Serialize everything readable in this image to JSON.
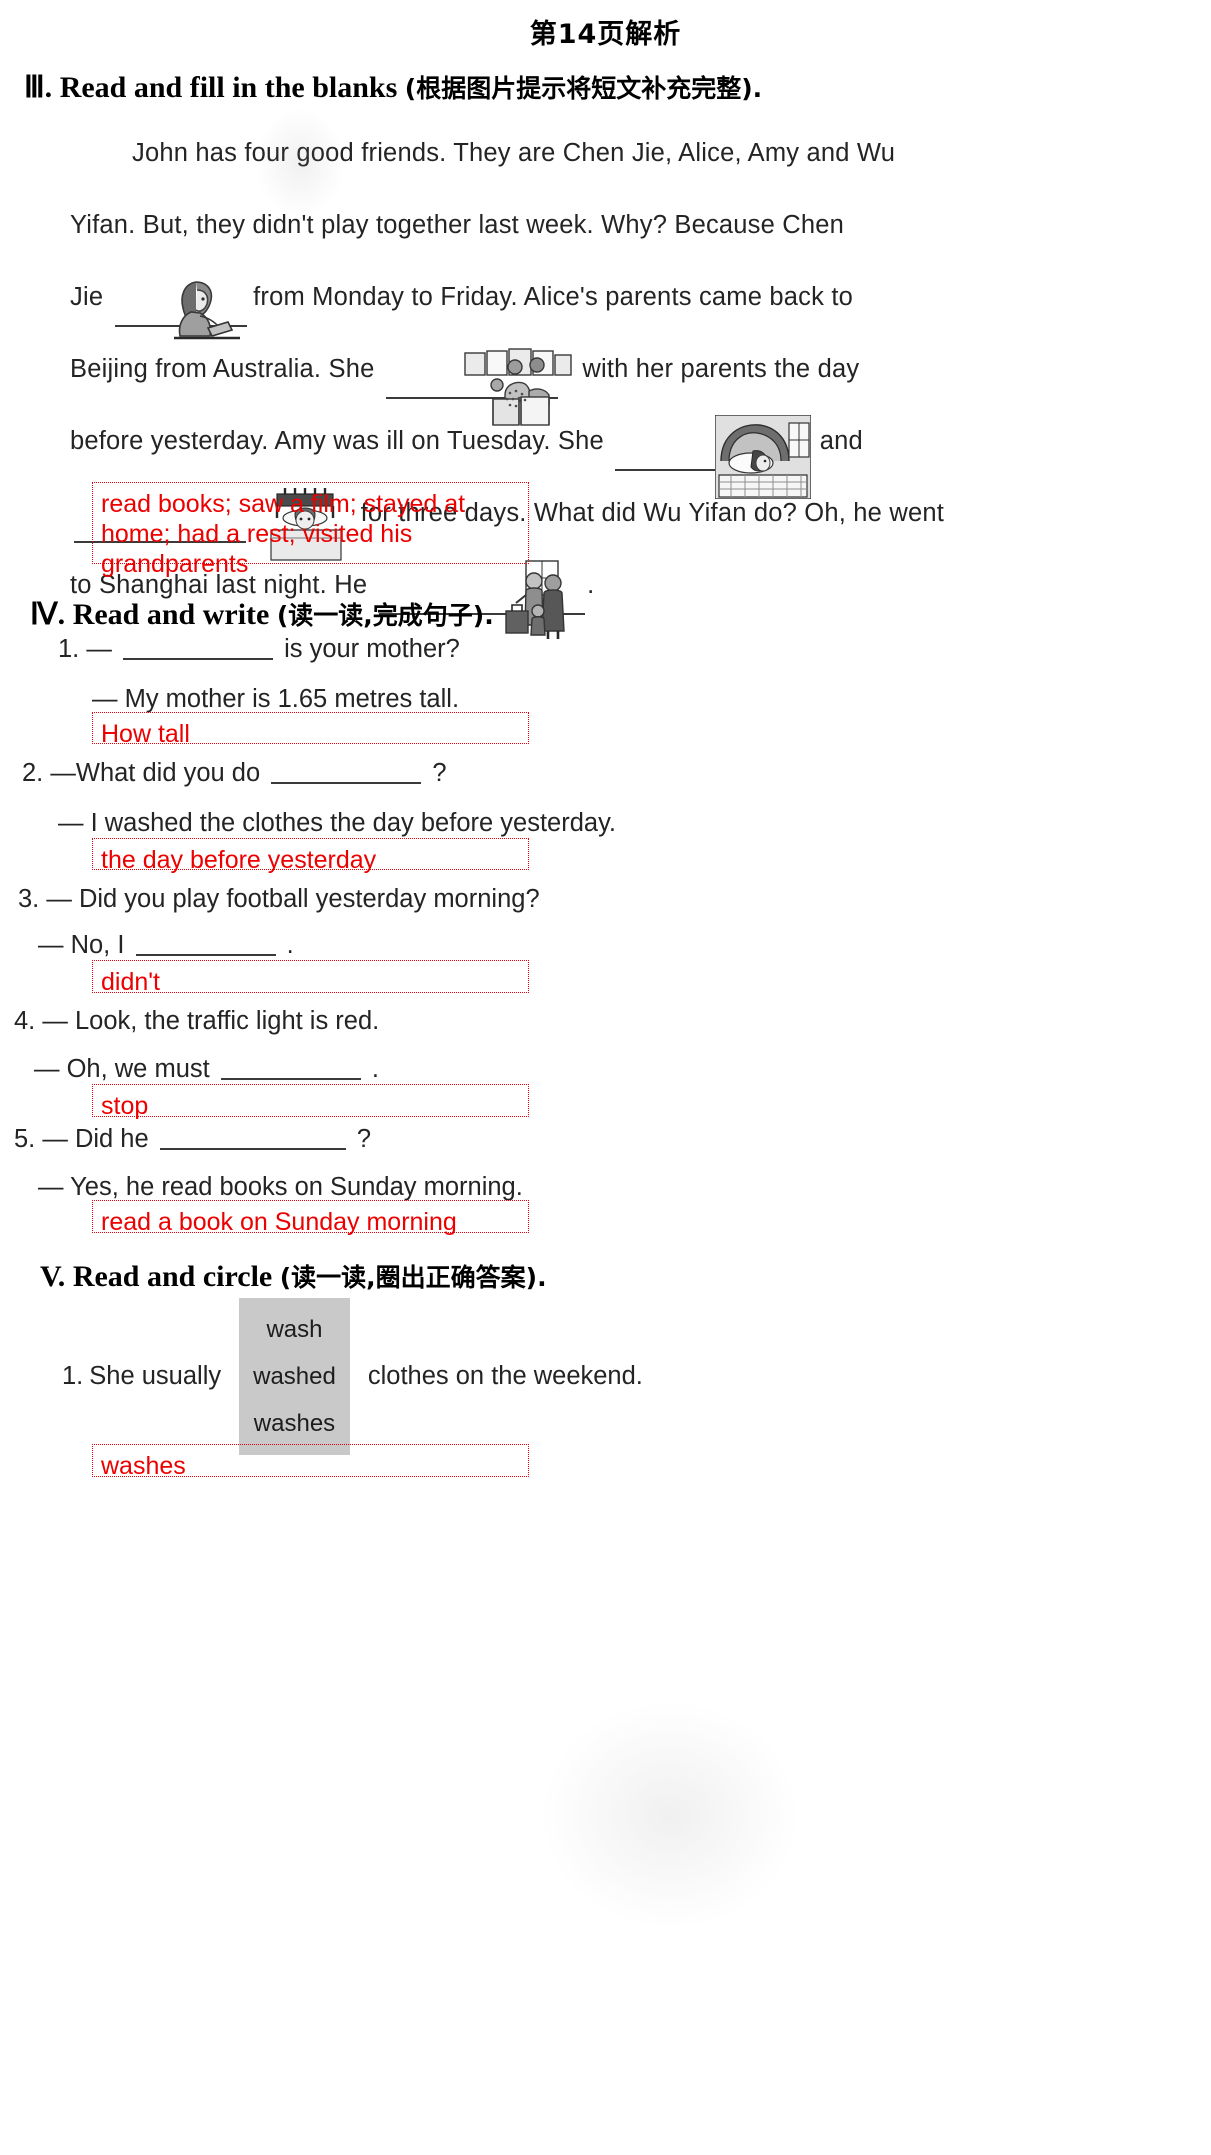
{
  "page": {
    "title": "第14页解析"
  },
  "section3": {
    "number": "Ⅲ.",
    "title_en": "Read and fill in the blanks",
    "title_zh": "(根据图片提示将短文补充完整).",
    "passage": {
      "p1": "John has four good friends. They are Chen Jie, Alice, Amy and Wu",
      "p2": "Yifan. But, they didn't play together last week. Why? Because Chen",
      "p3a": "Jie",
      "p3b": "from Monday to Friday. Alice's parents came back to",
      "p4a": "Beijing from Australia. She",
      "p4b": "with her parents the day",
      "p5a": "before yesterday. Amy was ill on Tuesday. She",
      "p5b": "and",
      "p6b": "for three days. What did Wu Yifan do? Oh, he went",
      "p7a": "to Shanghai last night. He",
      "p7b": "."
    },
    "images": [
      {
        "name": "girl-reading-book-illustration",
        "alt": "girl reading a book at a desk"
      },
      {
        "name": "people-watching-film-illustration",
        "alt": "people sitting in a cinema watching a film"
      },
      {
        "name": "girl-in-bed-resting-illustration",
        "alt": "girl lying ill in bed"
      },
      {
        "name": "child-in-bed-illustration",
        "alt": "child resting in bed"
      },
      {
        "name": "visiting-grandparents-illustration",
        "alt": "boy visiting grandparents at the door"
      }
    ],
    "answer": "read books; saw a film; stayed at home; had a rest; visited his grandparents"
  },
  "section4": {
    "number": "Ⅳ.",
    "title_en": "Read and write",
    "title_zh": "(读一读,完成句子).",
    "questions": [
      {
        "num": "1.",
        "q_pre": "—",
        "q_post": "is your mother?",
        "a_line": "— My mother is 1.65 metres tall.",
        "answer": "How tall"
      },
      {
        "num": "2.",
        "q_pre": "—What did you do",
        "q_post": "?",
        "a_line": "— I washed the clothes the day before yesterday.",
        "answer": "the day before yesterday"
      },
      {
        "num": "3.",
        "q_pre": "— Did you play football yesterday morning?",
        "q_post": "",
        "a_line": "— No, I",
        "a_post": ".",
        "answer": "didn't"
      },
      {
        "num": "4.",
        "q_pre": "— Look, the traffic light is red.",
        "q_post": "",
        "a_line": "— Oh, we must",
        "a_post": ".",
        "answer": "stop"
      },
      {
        "num": "5.",
        "q_pre": "— Did he",
        "q_post": "?",
        "a_line": "— Yes, he read books on Sunday morning.",
        "answer": "read a book on Sunday morning"
      }
    ]
  },
  "section5": {
    "number": "V.",
    "title_en": "Read and circle",
    "title_zh": "(读一读,圈出正确答案).",
    "question": {
      "num": "1.",
      "pre": "She usually",
      "options": [
        "wash",
        "washed",
        "washes"
      ],
      "post": "clothes on the weekend.",
      "answer": "washes"
    }
  },
  "colors": {
    "answer_red": "#ec0000",
    "text_black": "#242424",
    "option_bg": "#c9c9c9"
  }
}
